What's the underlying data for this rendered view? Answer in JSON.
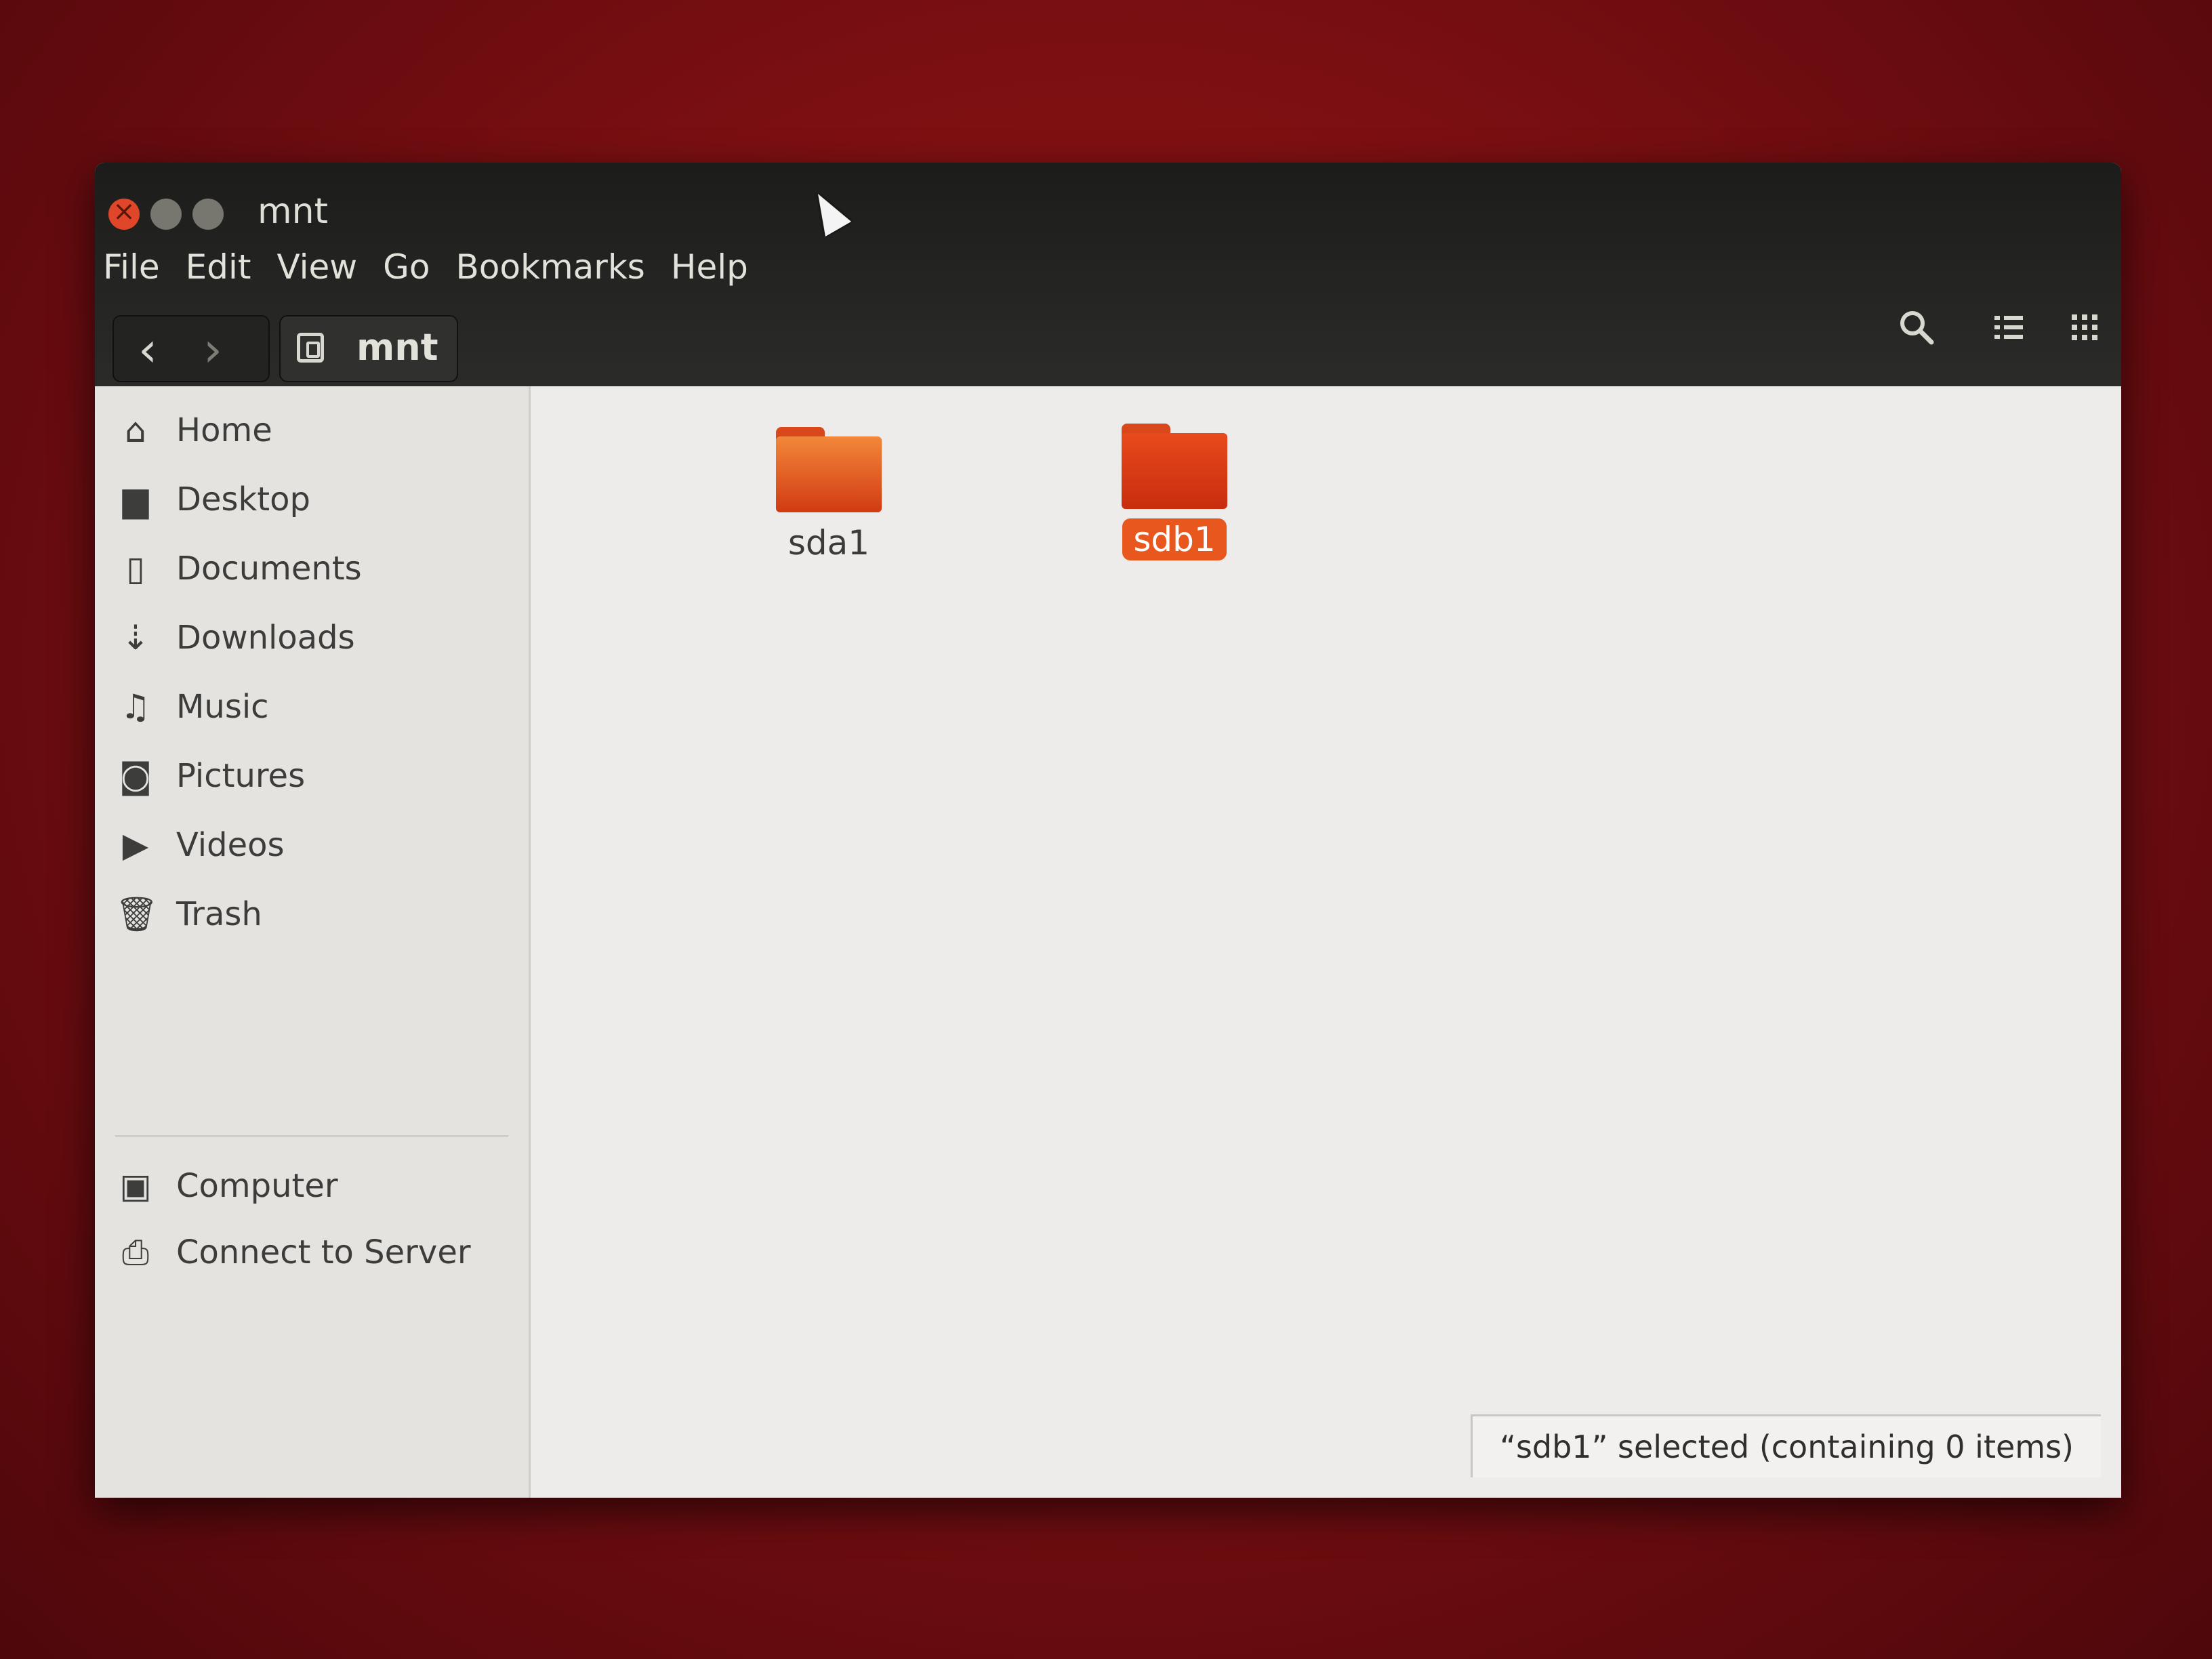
{
  "window": {
    "title": "mnt",
    "menu": [
      "File",
      "Edit",
      "View",
      "Go",
      "Bookmarks",
      "Help"
    ]
  },
  "toolbar": {
    "back_icon": "chevron-left-icon",
    "forward_icon": "chevron-right-icon",
    "path_icon": "drive-icon",
    "path_label": "mnt",
    "search_icon": "search-icon",
    "list_view_icon": "list-view-icon",
    "grid_view_icon": "grid-view-icon"
  },
  "sidebar": {
    "places": [
      {
        "label": "Home",
        "icon": "home-icon"
      },
      {
        "label": "Desktop",
        "icon": "folder-icon"
      },
      {
        "label": "Documents",
        "icon": "document-icon"
      },
      {
        "label": "Downloads",
        "icon": "download-icon"
      },
      {
        "label": "Music",
        "icon": "music-icon"
      },
      {
        "label": "Pictures",
        "icon": "camera-icon"
      },
      {
        "label": "Videos",
        "icon": "video-icon"
      },
      {
        "label": "Trash",
        "icon": "trash-icon"
      }
    ],
    "devices": [
      {
        "label": "Computer",
        "icon": "computer-icon"
      },
      {
        "label": "Connect to Server",
        "icon": "server-icon"
      }
    ]
  },
  "files": [
    {
      "name": "sda1",
      "selected": false
    },
    {
      "name": "sdb1",
      "selected": true
    }
  ],
  "status": "“sdb1” selected  (containing 0 items)",
  "colors": {
    "accent": "#e8571e",
    "titlebar": "#2b2b29",
    "desktop": "#8a1414"
  }
}
